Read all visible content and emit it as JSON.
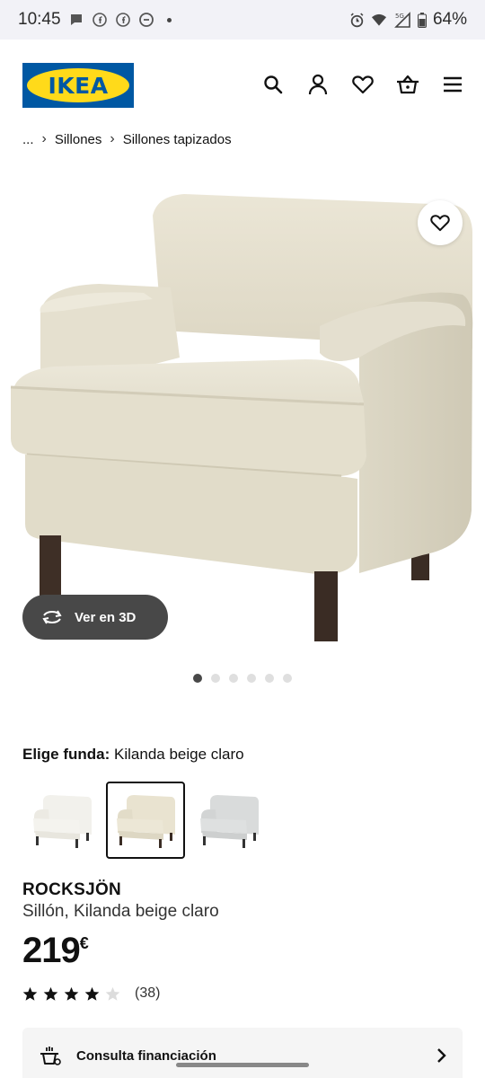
{
  "status_bar": {
    "time": "10:45",
    "battery": "64%",
    "network": "5G"
  },
  "header": {
    "logo_text": "IKEA",
    "brand_colors": {
      "blue": "#0058a3",
      "yellow": "#ffda1a"
    },
    "icons": [
      "search-icon",
      "account-icon",
      "heart-icon",
      "basket-icon",
      "menu-icon"
    ]
  },
  "breadcrumb": {
    "items": [
      "...",
      "Sillones",
      "Sillones tapizados"
    ]
  },
  "gallery": {
    "view_3d_label": "Ver en 3D",
    "total_images": 6,
    "active_image": 1
  },
  "cover": {
    "label": "Elige funda:",
    "selected_value": "Kilanda beige claro",
    "options": [
      "white",
      "beige",
      "grey"
    ],
    "selected_index": 1
  },
  "product": {
    "name": "ROCKSJÖN",
    "description": "Sillón, Kilanda beige claro",
    "price": "219",
    "currency": "€",
    "rating": 4,
    "rating_max": 5,
    "review_count": "(38)"
  },
  "finance": {
    "label": "Consulta financiación"
  }
}
